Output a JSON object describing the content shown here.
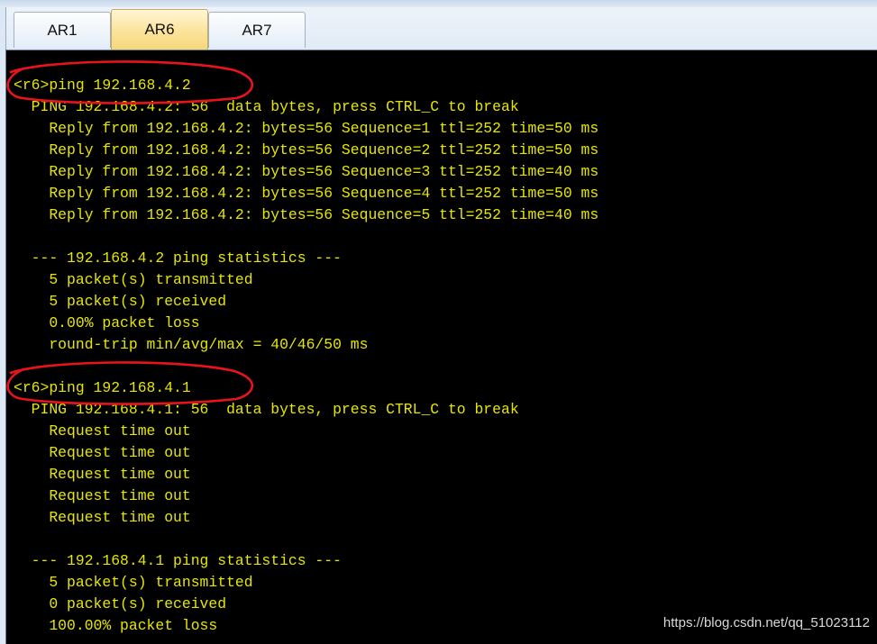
{
  "tabs": [
    {
      "label": "AR1",
      "active": false
    },
    {
      "label": "AR6",
      "active": true
    },
    {
      "label": "AR7",
      "active": false
    }
  ],
  "terminal": {
    "text_color": "#e6e600",
    "background": "#000000",
    "lines": [
      "<r6>ping 192.168.4.2",
      "  PING 192.168.4.2: 56  data bytes, press CTRL_C to break",
      "    Reply from 192.168.4.2: bytes=56 Sequence=1 ttl=252 time=50 ms",
      "    Reply from 192.168.4.2: bytes=56 Sequence=2 ttl=252 time=50 ms",
      "    Reply from 192.168.4.2: bytes=56 Sequence=3 ttl=252 time=40 ms",
      "    Reply from 192.168.4.2: bytes=56 Sequence=4 ttl=252 time=50 ms",
      "    Reply from 192.168.4.2: bytes=56 Sequence=5 ttl=252 time=40 ms",
      "",
      "  --- 192.168.4.2 ping statistics ---",
      "    5 packet(s) transmitted",
      "    5 packet(s) received",
      "    0.00% packet loss",
      "    round-trip min/avg/max = 40/46/50 ms",
      "",
      "<r6>ping 192.168.4.1",
      "  PING 192.168.4.1: 56  data bytes, press CTRL_C to break",
      "    Request time out",
      "    Request time out",
      "    Request time out",
      "    Request time out",
      "    Request time out",
      "",
      "  --- 192.168.4.1 ping statistics ---",
      "    5 packet(s) transmitted",
      "    0 packet(s) received",
      "    100.00% packet loss"
    ]
  },
  "annotation_color": "#e8141c",
  "watermark": "https://blog.csdn.net/qq_51023112"
}
